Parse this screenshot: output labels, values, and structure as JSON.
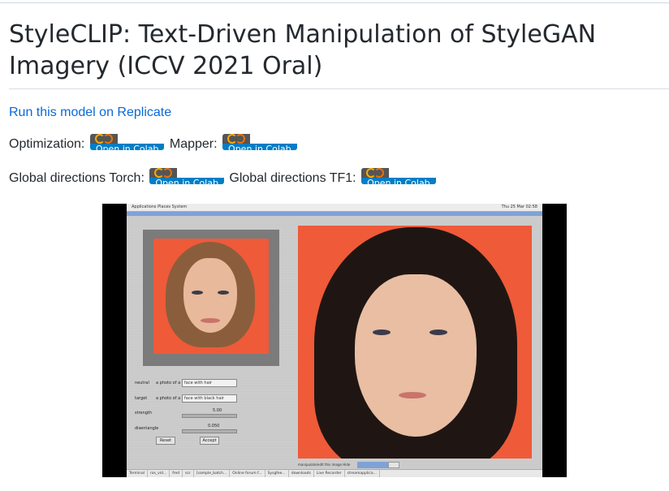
{
  "title": "StyleCLIP: Text-Driven Manipulation of StyleGAN Imagery (ICCV 2021 Oral)",
  "replicate_link": "Run this model on Replicate",
  "rows": [
    {
      "items": [
        {
          "label": "Optimization:",
          "badge": "Open in Colab"
        },
        {
          "label": "Mapper:",
          "badge": "Open in Colab"
        }
      ]
    },
    {
      "items": [
        {
          "label": "Global directions Torch:",
          "badge": "Open in Colab"
        },
        {
          "label": "Global directions TF1:",
          "badge": "Open in Colab"
        }
      ]
    }
  ],
  "colors": {
    "link": "#0969da",
    "badge_left": "#555555",
    "badge_right": "#007ec6",
    "colab_orange": "#f9ab00",
    "colab_dark_orange": "#e8710a",
    "portrait_bg": "#ef5a39"
  },
  "demo": {
    "topbar_left": "Applications  Places  System",
    "topbar_right": "Thu 25 Mar 02:58",
    "controls": {
      "neutral_label": "neutral",
      "neutral_prefix": "a photo of a",
      "neutral_value": "face with hair",
      "target_label": "target",
      "target_prefix": "a photo of a",
      "target_value": "face with black hair",
      "strength_label": "strength",
      "strength_value": "5.00",
      "disentangle_label": "disentangle",
      "disentangle_value": "0.050",
      "reset_label": "Reset",
      "accept_label": "Accept"
    },
    "bottom_text": "manipulate/edit this image     Hide",
    "taskbar": [
      "Terminal",
      "ros_vid...",
      "fred",
      "scr",
      "[sample_batch...",
      "Online forum f...",
      "Sysgfee...",
      "downloads",
      "Live Recorder",
      "streamapplica..."
    ]
  }
}
